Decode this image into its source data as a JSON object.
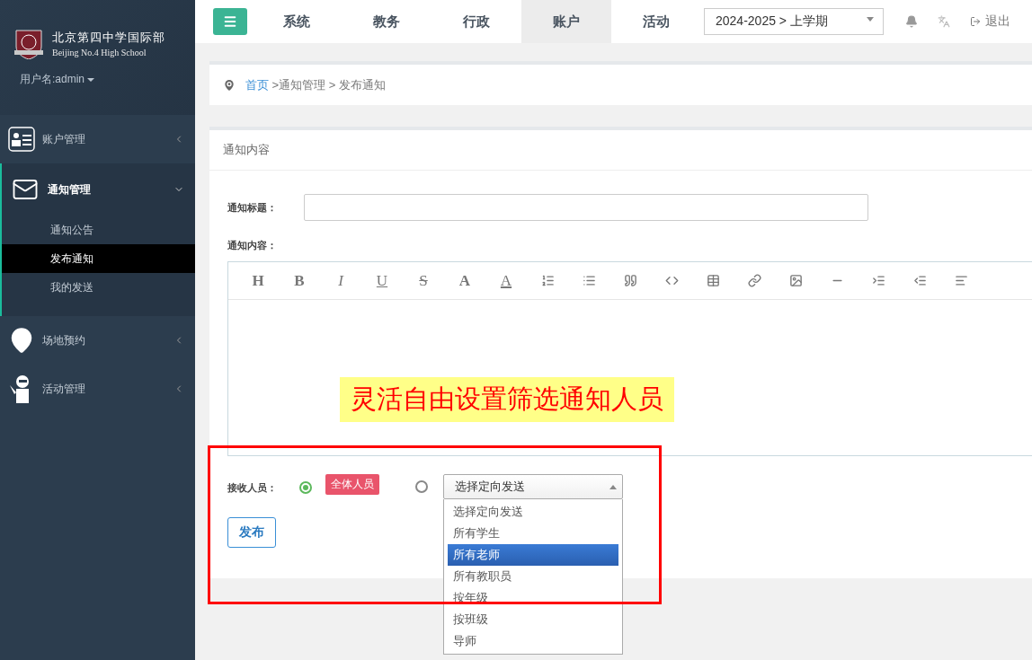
{
  "sidebar": {
    "logo": {
      "name": "北京第四中学国际部",
      "subtitle": "Beijing No.4 High School"
    },
    "user": "用户名:admin",
    "items": [
      {
        "label": "账户管理",
        "kind": "card",
        "expanded": false
      },
      {
        "label": "通知管理",
        "kind": "mail",
        "expanded": true,
        "children": [
          {
            "label": "通知公告",
            "selected": false
          },
          {
            "label": "发布通知",
            "selected": true
          },
          {
            "label": "我的发送",
            "selected": false
          }
        ]
      },
      {
        "label": "场地预约",
        "kind": "pin",
        "expanded": false
      },
      {
        "label": "活动管理",
        "kind": "person",
        "expanded": false
      }
    ]
  },
  "topbar": {
    "tabs": [
      {
        "label": "系统",
        "selected": false
      },
      {
        "label": "教务",
        "selected": false
      },
      {
        "label": "行政",
        "selected": false
      },
      {
        "label": "账户",
        "selected": true
      },
      {
        "label": "活动",
        "selected": false
      }
    ],
    "term": "2024-2025 > 上学期",
    "logout": "退出"
  },
  "breadcrumb": {
    "home": "首页",
    "path": " >通知管理 > 发布通知"
  },
  "form": {
    "header": "通知内容",
    "title_label": "通知标题：",
    "content_label": "通知内容：",
    "toolbar": [
      {
        "kind": "heading",
        "text": "H"
      },
      {
        "kind": "bold",
        "text": "B"
      },
      {
        "kind": "italic",
        "text": "I"
      },
      {
        "kind": "underline",
        "text": "U"
      },
      {
        "kind": "strike",
        "text": "S"
      },
      {
        "kind": "font",
        "text": "A"
      },
      {
        "kind": "color",
        "text": "A"
      },
      {
        "kind": "olist"
      },
      {
        "kind": "ulist"
      },
      {
        "kind": "quote"
      },
      {
        "kind": "code"
      },
      {
        "kind": "table"
      },
      {
        "kind": "link"
      },
      {
        "kind": "image"
      },
      {
        "kind": "rule"
      },
      {
        "kind": "indent"
      },
      {
        "kind": "outdent"
      },
      {
        "kind": "align"
      }
    ],
    "recipients_label": "接收人员：",
    "radios": [
      {
        "selected": true,
        "kind": "tag",
        "label": "全体人员"
      },
      {
        "selected": false,
        "kind": "select",
        "label": "选择定向发送"
      }
    ],
    "options": [
      {
        "label": "选择定向发送",
        "selected": false
      },
      {
        "label": "所有学生",
        "selected": false
      },
      {
        "label": "所有老师",
        "selected": true
      },
      {
        "label": "所有教职员",
        "selected": false
      },
      {
        "label": "按年级",
        "selected": false
      },
      {
        "label": "按班级",
        "selected": false
      },
      {
        "label": "导师",
        "selected": false
      }
    ],
    "submit": "发布"
  },
  "annotation": {
    "callout": "灵活自由设置筛选通知人员"
  }
}
